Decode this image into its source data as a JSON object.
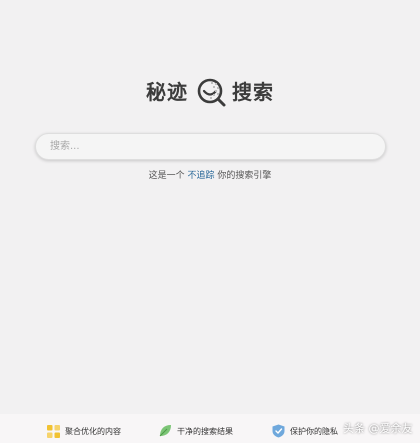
{
  "logo": {
    "left_text": "秘迹",
    "right_text": "搜索",
    "mark_icon": "magnifier-smile-icon"
  },
  "search": {
    "placeholder": "搜索...",
    "value": ""
  },
  "tagline": {
    "prefix": "这是一个",
    "highlight": "不追踪",
    "suffix": "你的搜索引擎",
    "highlight_color": "#2c6a9a"
  },
  "features": [
    {
      "label": "聚合优化的内容",
      "icon": "grid-squares-icon",
      "color": "#f1c232"
    },
    {
      "label": "干净的搜索结果",
      "icon": "leaf-icon",
      "color": "#7cc576"
    },
    {
      "label": "保护你的隐私",
      "icon": "shield-icon",
      "color": "#6fa8dc"
    }
  ],
  "watermark": "头条 @爱余友"
}
